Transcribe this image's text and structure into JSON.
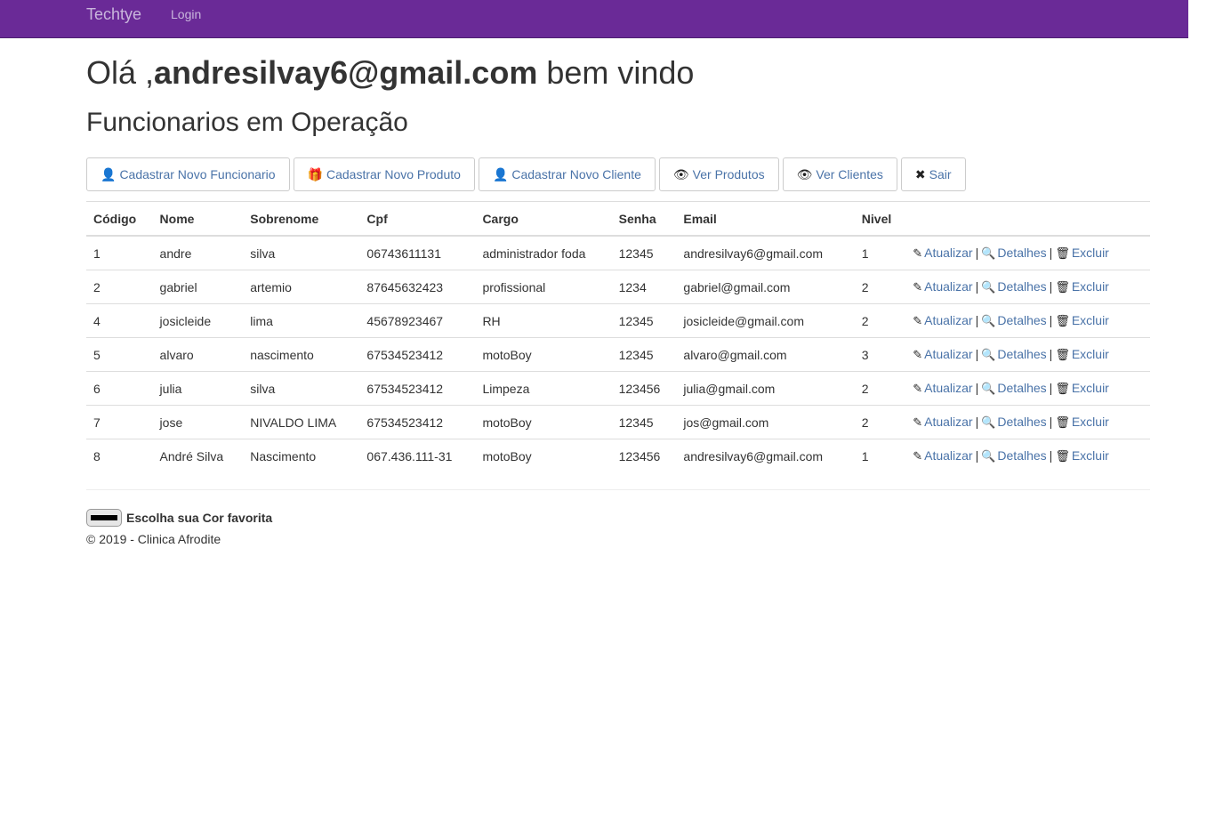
{
  "navbar": {
    "brand": "Techtye",
    "login": "Login",
    "bg_color": "#6a2a97"
  },
  "header": {
    "greeting_prefix": "Olá ,",
    "user_email": "andresilvay6@gmail.com",
    "greeting_suffix": " bem vindo",
    "subtitle": "Funcionarios em Operação"
  },
  "toolbar": {
    "buttons": [
      {
        "icon": "user-icon",
        "glyph": "👤",
        "label": "Cadastrar Novo Funcionario"
      },
      {
        "icon": "gift-icon",
        "glyph": "🎁",
        "label": "Cadastrar Novo Produto"
      },
      {
        "icon": "user-icon",
        "glyph": "👤",
        "label": "Cadastrar Novo Cliente"
      },
      {
        "icon": "eye-icon",
        "glyph": "👁",
        "label": "Ver Produtos"
      },
      {
        "icon": "eye-icon",
        "glyph": "👁",
        "label": "Ver Clientes"
      },
      {
        "icon": "close-icon",
        "glyph": "✖",
        "label": "Sair"
      }
    ]
  },
  "table": {
    "columns": [
      "Código",
      "Nome",
      "Sobrenome",
      "Cpf",
      "Cargo",
      "Senha",
      "Email",
      "Nivel",
      ""
    ],
    "actions": {
      "update": "Atualizar",
      "details": "Detalhes",
      "delete": "Excluir",
      "separator": "|"
    },
    "rows": [
      [
        "1",
        "andre",
        "silva",
        "06743611131",
        "administrador foda",
        "12345",
        "andresilvay6@gmail.com",
        "1"
      ],
      [
        "2",
        "gabriel",
        "artemio",
        "87645632423",
        "profissional",
        "1234",
        "gabriel@gmail.com",
        "2"
      ],
      [
        "4",
        "josicleide",
        "lima",
        "45678923467",
        "RH",
        "12345",
        "josicleide@gmail.com",
        "2"
      ],
      [
        "5",
        "alvaro",
        "nascimento",
        "67534523412",
        "motoBoy",
        "12345",
        "alvaro@gmail.com",
        "3"
      ],
      [
        "6",
        "julia",
        "silva",
        "67534523412",
        "Limpeza",
        "123456",
        "julia@gmail.com",
        "2"
      ],
      [
        "7",
        "jose",
        "NIVALDO LIMA",
        "67534523412",
        "motoBoy",
        "12345",
        "jos@gmail.com",
        "2"
      ],
      [
        "8",
        "André Silva",
        "Nascimento",
        "067.436.111-31",
        "motoBoy",
        "123456",
        "andresilvay6@gmail.com",
        "1"
      ]
    ]
  },
  "footer": {
    "color_label": "Escolha sua Cor favorita",
    "color_value": "#000000",
    "copyright": "© 2019 - Clinica Afrodite"
  }
}
